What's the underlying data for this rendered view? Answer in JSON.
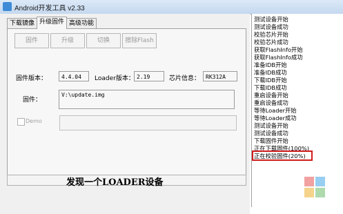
{
  "window": {
    "title": "Android开发工具 v2.33"
  },
  "tabs": [
    {
      "label": "下载镜像"
    },
    {
      "label": "升级固件"
    },
    {
      "label": "高级功能"
    }
  ],
  "buttons": {
    "firmware": "固件",
    "upgrade": "升级",
    "switch": "切换",
    "erase_flash": "擦除Flash"
  },
  "info": {
    "firmware_version_label": "固件版本：",
    "firmware_version_value": "4.4.04",
    "loader_version_label": "Loader版本：",
    "loader_version_value": "2.19",
    "chip_info_label": "芯片信息：",
    "chip_info_value": "RK312A",
    "firmware_label": "固件：",
    "firmware_path": "V:\\update.img"
  },
  "demo": {
    "label": "Demo",
    "checked": false
  },
  "status": {
    "message": "发现一个LOADER设备"
  },
  "log": [
    "测试设备开始",
    "测试设备成功",
    "校验芯片开始",
    "校验芯片成功",
    "获取FlashInfo开始",
    "获取FlashInfo成功",
    "准备IDB开始",
    "准备IDB成功",
    "下载IDB开始",
    "下载IDB成功",
    "重启设备开始",
    "重启设备成功",
    "等待Loader开始",
    "等待Loader成功",
    "测试设备开始",
    "测试设备成功",
    "下载固件开始",
    "正在下载固件(100%)",
    "正在校验固件(20%)"
  ],
  "colors": {
    "highlight": "#d01c1c",
    "titlebar": "#c4d8ef"
  }
}
